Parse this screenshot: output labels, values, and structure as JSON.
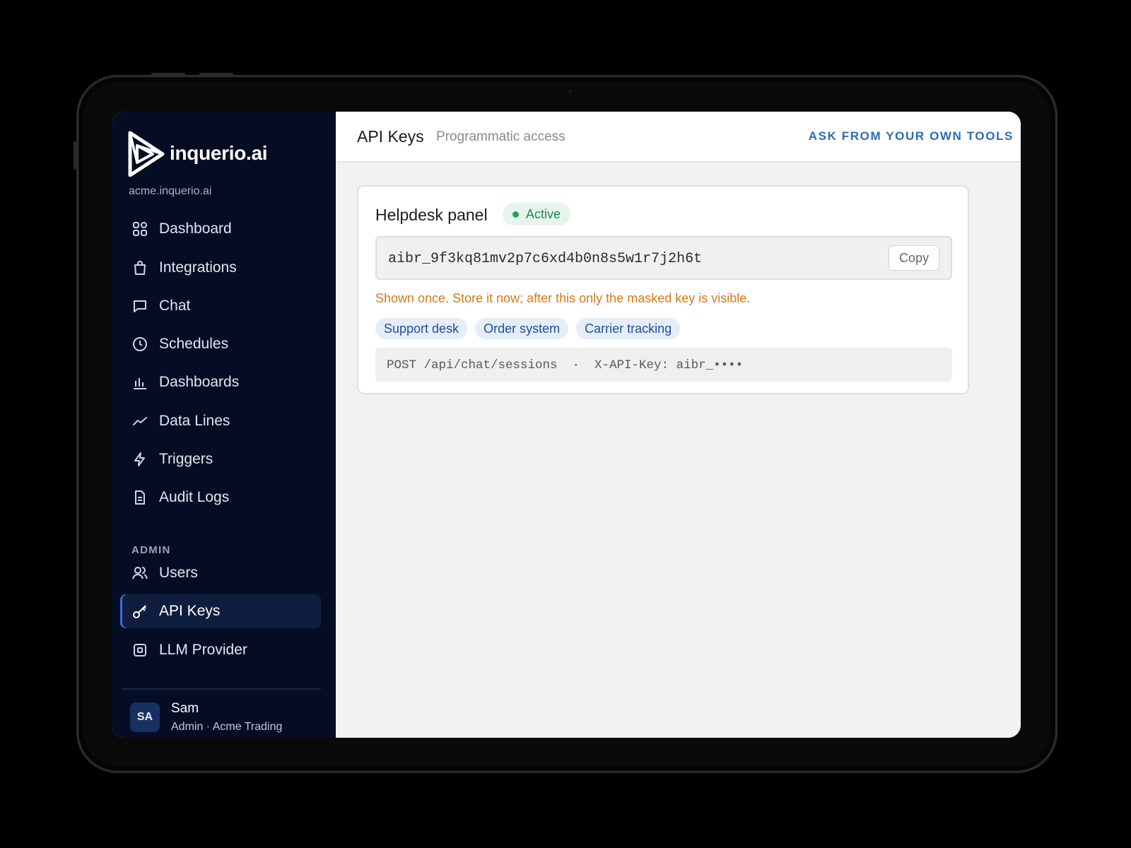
{
  "brand": {
    "name": "inquerio.ai",
    "tenant": "acme.inquerio.ai"
  },
  "sidebar": {
    "items": [
      {
        "label": "Dashboard",
        "icon": "grid-icon"
      },
      {
        "label": "Integrations",
        "icon": "bag-icon"
      },
      {
        "label": "Chat",
        "icon": "chat-bubble-icon"
      },
      {
        "label": "Schedules",
        "icon": "clock-icon"
      },
      {
        "label": "Dashboards",
        "icon": "bar-chart-icon"
      },
      {
        "label": "Data Lines",
        "icon": "trend-line-icon"
      },
      {
        "label": "Triggers",
        "icon": "lightning-icon"
      },
      {
        "label": "Audit Logs",
        "icon": "document-icon"
      }
    ],
    "admin_label": "ADMIN",
    "admin_items": [
      {
        "label": "Users",
        "icon": "users-icon"
      },
      {
        "label": "API Keys",
        "icon": "key-icon",
        "active": true
      },
      {
        "label": "LLM Provider",
        "icon": "chip-icon"
      }
    ],
    "user": {
      "initials": "SA",
      "name": "Sam",
      "role": "Admin · Acme Trading"
    }
  },
  "header": {
    "title": "API Keys",
    "subtitle": "Programmatic access",
    "action": "ASK FROM YOUR OWN TOOLS"
  },
  "key_card": {
    "name": "Helpdesk panel",
    "status": "Active",
    "key": "aibr_9f3kq81mv2p7c6xd4b0n8s5w1r7j2h6t",
    "copy_label": "Copy",
    "warning": "Shown once. Store it now; after this only the masked key is visible.",
    "scopes": [
      "Support desk",
      "Order system",
      "Carrier tracking"
    ],
    "endpoint": "POST /api/chat/sessions  ·  X-API-Key: aibr_••••"
  },
  "colors": {
    "sidebar_bg": "#050d24",
    "active_accent": "#3d6ad6",
    "link": "#2b6bb7",
    "status_green": "#21a35b",
    "warning": "#d47a1a",
    "tag_text": "#1f4f99"
  }
}
